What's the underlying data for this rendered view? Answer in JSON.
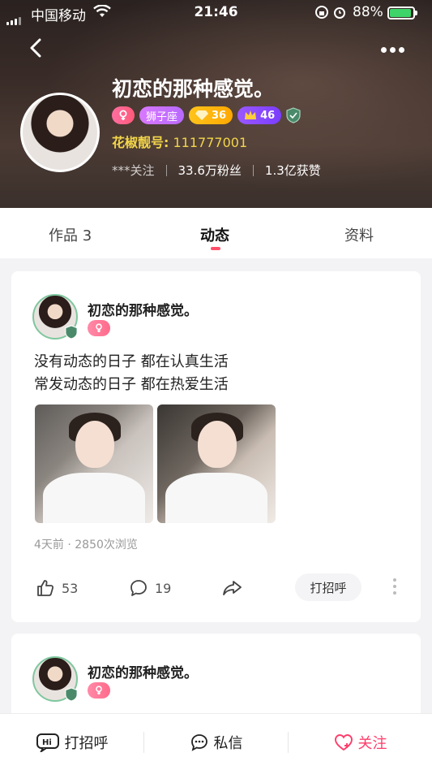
{
  "status_bar": {
    "carrier": "中国移动",
    "time": "21:46",
    "battery": "88%"
  },
  "header": {
    "name": "初恋的那种感觉。",
    "tags": {
      "zodiac": "狮子座",
      "gem_level": "36",
      "crown_level": "46"
    },
    "id_label": "花椒靓号:",
    "id_value": "111777001",
    "following": "***关注",
    "fans": "33.6万粉丝",
    "likes": "1.3亿获赞"
  },
  "tabs": [
    {
      "label": "作品 3"
    },
    {
      "label": "动态"
    },
    {
      "label": "资料"
    }
  ],
  "posts": [
    {
      "author": "初恋的那种感觉。",
      "text_line1": "没有动态的日子 都在认真生活",
      "text_line2": "常发动态的日子 都在热爱生活",
      "meta": "4天前 · 2850次浏览",
      "likes": "53",
      "comments": "19",
      "greet": "打招呼"
    },
    {
      "author": "初恋的那种感觉。"
    }
  ],
  "bottom_bar": {
    "greet": "打招呼",
    "message": "私信",
    "follow": "关注"
  },
  "colors": {
    "accent": "#ff4e6a",
    "follow": "#ff3d6b",
    "gem": "#ffa800",
    "crown": "#7a3dff",
    "id_gold": "#f2d54a"
  }
}
